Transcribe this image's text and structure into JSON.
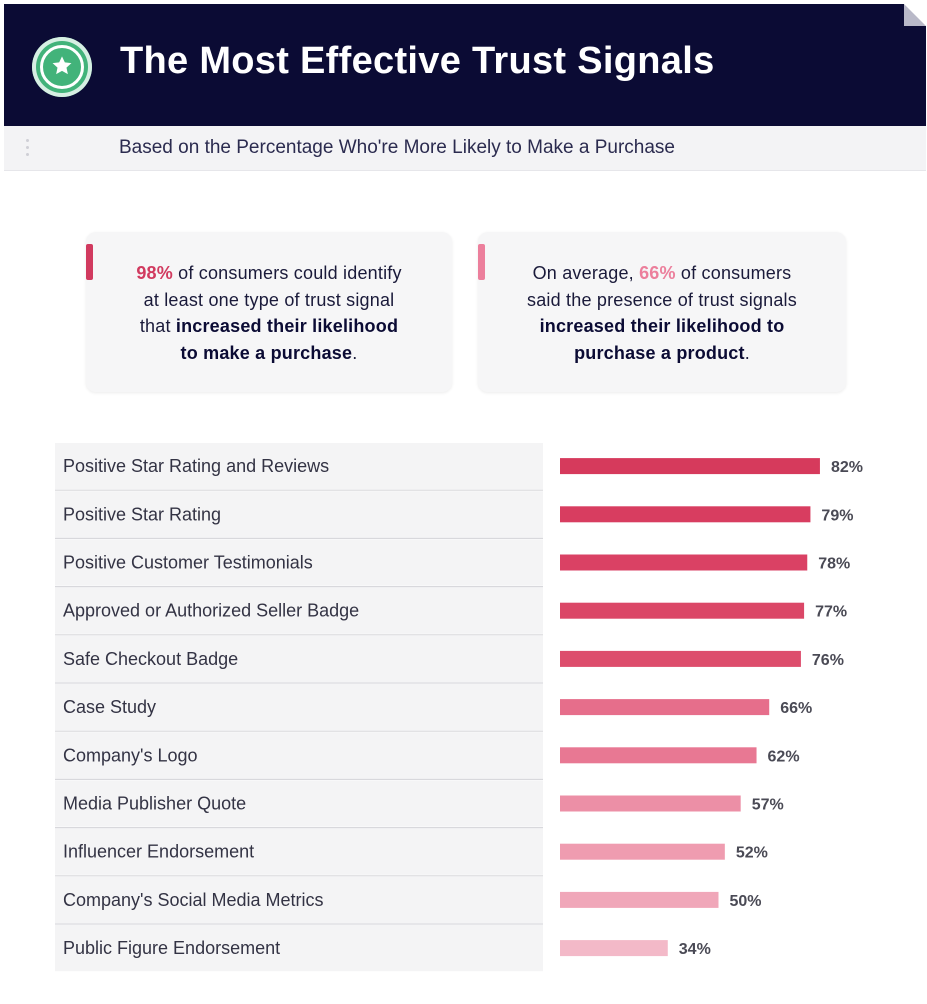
{
  "header": {
    "title": "The Most Effective Trust Signals",
    "subtitle": "Based on the Percentage Who're More Likely to Make a Purchase",
    "icon": "star-icon",
    "colors": {
      "background": "#0b0b34",
      "badge": "#42b37a"
    }
  },
  "cards": [
    {
      "highlight": "98%",
      "line1_rest": " of consumers could identify",
      "line2": "at least one type of trust signal",
      "line3_pre": "that ",
      "bold_a": "increased their likelihood",
      "bold_b": "to make a purchase",
      "end": ".",
      "accent_color": "#d13a5f"
    },
    {
      "pre": "On average, ",
      "highlight": "66%",
      "line1_rest": " of consumers",
      "line2": "said the presence of trust signals",
      "bold_a": "increased their likelihood to",
      "bold_b": "purchase a product",
      "end": ".",
      "accent_color": "#ec7f9c"
    }
  ],
  "chart_data": {
    "type": "bar",
    "orientation": "horizontal",
    "categories": [
      "Positive Star Rating and Reviews",
      "Positive Star Rating",
      "Positive Customer Testimonials",
      "Approved or Authorized Seller Badge",
      "Safe Checkout Badge",
      "Case Study",
      "Company's Logo",
      "Media Publisher Quote",
      "Influencer Endorsement",
      "Company's Social Media Metrics",
      "Public Figure Endorsement"
    ],
    "values": [
      82,
      79,
      78,
      77,
      76,
      66,
      62,
      57,
      52,
      50,
      34
    ],
    "value_labels": [
      "82%",
      "79%",
      "78%",
      "77%",
      "76%",
      "66%",
      "62%",
      "57%",
      "52%",
      "50%",
      "34%"
    ],
    "bar_colors": [
      "#d63a5c",
      "#d83d60",
      "#da4164",
      "#db4767",
      "#dd4d6c",
      "#e66e8b",
      "#e87893",
      "#ec8fa6",
      "#ef9cb0",
      "#f0a7b9",
      "#f3b9c8"
    ],
    "xlim": [
      0,
      100
    ],
    "grid": false,
    "legend": "none"
  }
}
